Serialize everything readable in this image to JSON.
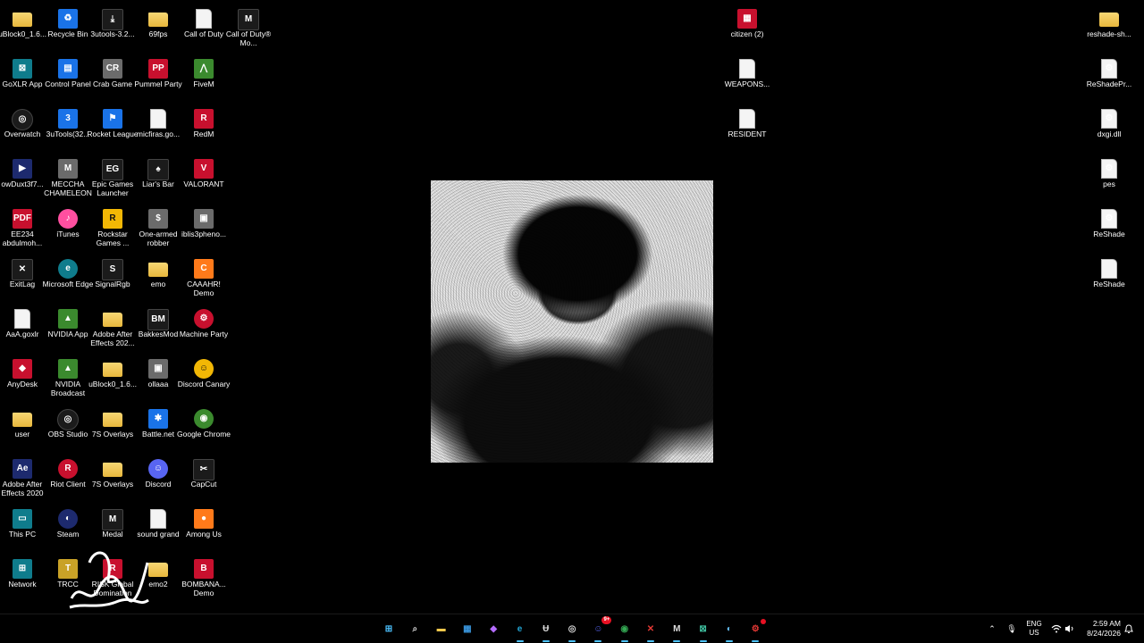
{
  "desktop_icons": [
    {
      "label": "uBlock0_1.6...",
      "icon": "folder"
    },
    {
      "label": "Recycle Bin",
      "icon": "recycle-bin"
    },
    {
      "label": "3utools-3.2...",
      "icon": "download"
    },
    {
      "label": "69fps",
      "icon": "folder"
    },
    {
      "label": "Call of Duty",
      "icon": "doc"
    },
    {
      "label": "Call of Duty® Mo...",
      "icon": "cod-mobile"
    },
    {
      "label": "GoXLR App",
      "icon": "goxlr"
    },
    {
      "label": "Control Panel",
      "icon": "control-panel"
    },
    {
      "label": "Crab Game",
      "icon": "crab-game"
    },
    {
      "label": "Pummel Party",
      "icon": "pummel-party"
    },
    {
      "label": "FiveM",
      "icon": "fivem"
    },
    {
      "label": "Overwatch",
      "icon": "overwatch"
    },
    {
      "label": "3uTools(32...",
      "icon": "3utools"
    },
    {
      "label": "Rocket League",
      "icon": "rocket-league"
    },
    {
      "label": "micfiras.go...",
      "icon": "doc"
    },
    {
      "label": "RedM",
      "icon": "redm"
    },
    {
      "label": "owDuxt3f7...",
      "icon": "video-thumb"
    },
    {
      "label": "MECCHA CHAMELEON",
      "icon": "meccha"
    },
    {
      "label": "Epic Games Launcher",
      "icon": "epic"
    },
    {
      "label": "Liar's Bar",
      "icon": "liars-bar"
    },
    {
      "label": "VALORANT",
      "icon": "valorant"
    },
    {
      "label": "EE234 abdulmoh...",
      "icon": "pdf"
    },
    {
      "label": "iTunes",
      "icon": "itunes"
    },
    {
      "label": "Rockstar Games ...",
      "icon": "rockstar"
    },
    {
      "label": "One-armed robber",
      "icon": "one-armed-robber"
    },
    {
      "label": "iblis3pheno...",
      "icon": "image-thumb"
    },
    {
      "label": "ExitLag",
      "icon": "exitlag"
    },
    {
      "label": "Microsoft Edge",
      "icon": "edge"
    },
    {
      "label": "SignalRgb",
      "icon": "signalrgb"
    },
    {
      "label": "emo",
      "icon": "folder"
    },
    {
      "label": "CAAAHR! Demo",
      "icon": "caaahr"
    },
    {
      "label": "AaA.goxlr",
      "icon": "doc"
    },
    {
      "label": "NVIDIA App",
      "icon": "nvidia"
    },
    {
      "label": "Adobe After Effects 202...",
      "icon": "folder"
    },
    {
      "label": "BakkesMod",
      "icon": "bakkesmod"
    },
    {
      "label": "Machine Party",
      "icon": "machine-party"
    },
    {
      "label": "AnyDesk",
      "icon": "anydesk"
    },
    {
      "label": "NVIDIA Broadcast",
      "icon": "nvidia"
    },
    {
      "label": "uBlock0_1.6...",
      "icon": "folder"
    },
    {
      "label": "ollaaa",
      "icon": "image-thumb"
    },
    {
      "label": "Discord Canary",
      "icon": "discord-canary"
    },
    {
      "label": "user",
      "icon": "folder"
    },
    {
      "label": "OBS Studio",
      "icon": "obs"
    },
    {
      "label": "7S Overlays",
      "icon": "folder"
    },
    {
      "label": "Battle.net",
      "icon": "battlenet"
    },
    {
      "label": "Google Chrome",
      "icon": "chrome"
    },
    {
      "label": "Adobe After Effects 2020",
      "icon": "after-effects"
    },
    {
      "label": "Riot Client",
      "icon": "riot"
    },
    {
      "label": "7S Overlays",
      "icon": "folder"
    },
    {
      "label": "Discord",
      "icon": "discord"
    },
    {
      "label": "CapCut",
      "icon": "capcut"
    },
    {
      "label": "This PC",
      "icon": "this-pc"
    },
    {
      "label": "Steam",
      "icon": "steam"
    },
    {
      "label": "Medal",
      "icon": "medal"
    },
    {
      "label": "sound grand",
      "icon": "doc"
    },
    {
      "label": "Among Us",
      "icon": "among-us"
    },
    {
      "label": "Network",
      "icon": "network"
    },
    {
      "label": "TRCC",
      "icon": "trcc"
    },
    {
      "label": "RISK Global Domination",
      "icon": "risk"
    },
    {
      "label": "emo2",
      "icon": "folder"
    },
    {
      "label": "BOMBANA... Demo",
      "icon": "bombana"
    },
    {
      "label": "citizen (2)",
      "icon": "winrar"
    },
    {
      "label": "WEAPONS...",
      "icon": "doc"
    },
    {
      "label": "RESIDENT",
      "icon": "doc"
    },
    {
      "label": "reshade-sh...",
      "icon": "folder"
    },
    {
      "label": "ReShadePr...",
      "icon": "gear-doc"
    },
    {
      "label": "dxgi.dll",
      "icon": "gear-doc"
    },
    {
      "label": "pes",
      "icon": "gear-doc"
    },
    {
      "label": "ReShade",
      "icon": "gear-doc"
    },
    {
      "label": "ReShade",
      "icon": "doc"
    }
  ],
  "taskbar": {
    "pinned": [
      {
        "name": "start",
        "glyph": "⊞"
      },
      {
        "name": "search",
        "glyph": "⌕"
      },
      {
        "name": "file-explorer",
        "glyph": "▬"
      },
      {
        "name": "microsoft-store",
        "glyph": "▦"
      },
      {
        "name": "copilot",
        "glyph": "◆"
      },
      {
        "name": "edge",
        "glyph": "e"
      },
      {
        "name": "3utools",
        "glyph": "Ʉ"
      },
      {
        "name": "obs",
        "glyph": "◎"
      },
      {
        "name": "discord",
        "glyph": "☺",
        "badge": "9+"
      },
      {
        "name": "chrome",
        "glyph": "◉"
      },
      {
        "name": "exitlag",
        "glyph": "✕"
      },
      {
        "name": "medal",
        "glyph": "M"
      },
      {
        "name": "goxlr",
        "glyph": "⊠"
      },
      {
        "name": "steam",
        "glyph": "◐"
      },
      {
        "name": "riot",
        "glyph": "⚙"
      }
    ],
    "tray": {
      "overflow": "⌃",
      "mic": "🎙",
      "lang_line1": "ENG",
      "lang_line2": "US",
      "wifi": "wifi",
      "volume": "volume",
      "time": "2:59 AM",
      "date": "8/24/2026"
    }
  }
}
